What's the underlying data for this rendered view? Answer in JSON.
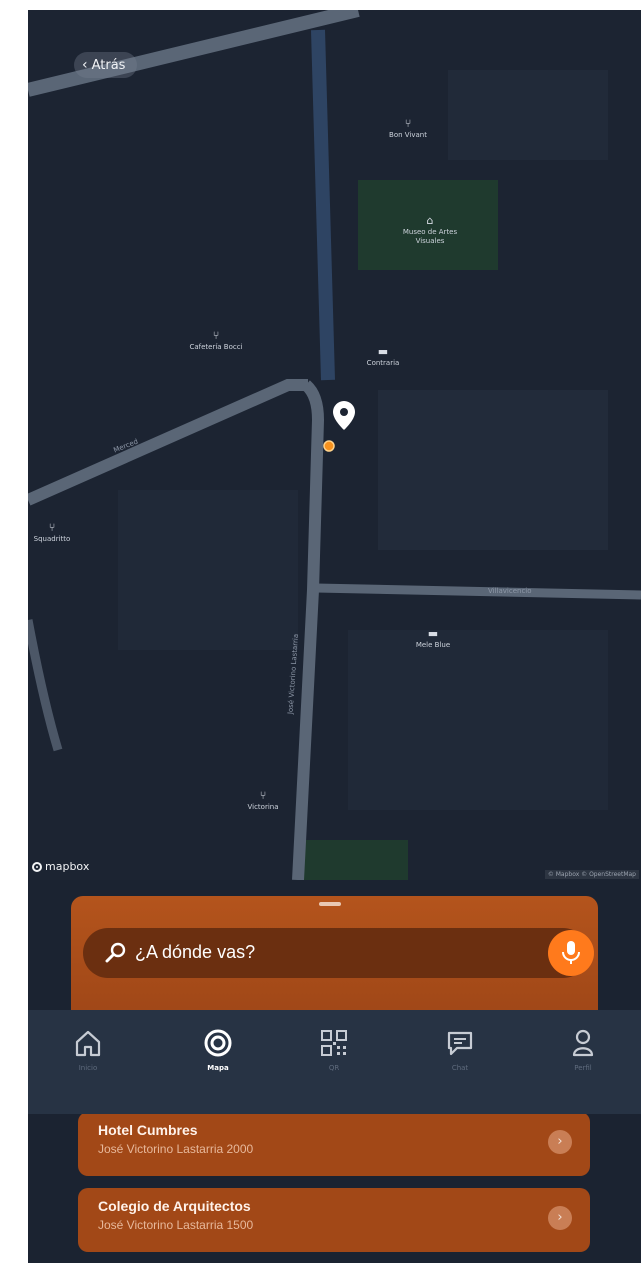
{
  "map": {
    "back_label": "Atrás",
    "mapbox_label": "mapbox",
    "attribution": "© Mapbox © OpenStreetMap",
    "pois": [
      {
        "name": "Bon Vivant",
        "glyph": "fork-knife"
      },
      {
        "name": "Museo de Artes Visuales",
        "glyph": "museum"
      },
      {
        "name": "Cafetería Bocci",
        "glyph": "fork-knife"
      },
      {
        "name": "Contraria",
        "glyph": "bed"
      },
      {
        "name": "Squadritto",
        "glyph": "fork-knife"
      },
      {
        "name": "Mele Blue",
        "glyph": "bed"
      },
      {
        "name": "Victorina",
        "glyph": "fork-knife"
      }
    ],
    "streets": {
      "diagonal": "Merced",
      "horizontal": "Villavicencio",
      "vertical": "José Victorino Lastarria"
    },
    "colors": {
      "background": "#1c2432",
      "road": "#5a6676",
      "park": "#1f3a2e",
      "pin": "#ffffff",
      "user": "#f7921e"
    }
  },
  "search": {
    "placeholder": "¿A dónde vas?",
    "accent": "#ff7a1c"
  },
  "nav": {
    "items": [
      {
        "label": "Inicio",
        "icon": "home-icon"
      },
      {
        "label": "Mapa",
        "icon": "target-icon",
        "active": true
      },
      {
        "label": "QR",
        "icon": "qr-code-icon"
      },
      {
        "label": "Chat",
        "icon": "chat-icon"
      },
      {
        "label": "Perfil",
        "icon": "user-icon"
      }
    ]
  },
  "results": [
    {
      "name": "Hotel Cumbres",
      "address": "José Victorino Lastarria 2000"
    },
    {
      "name": "Colegio de Arquitectos",
      "address": "José Victorino Lastarria 1500"
    }
  ]
}
